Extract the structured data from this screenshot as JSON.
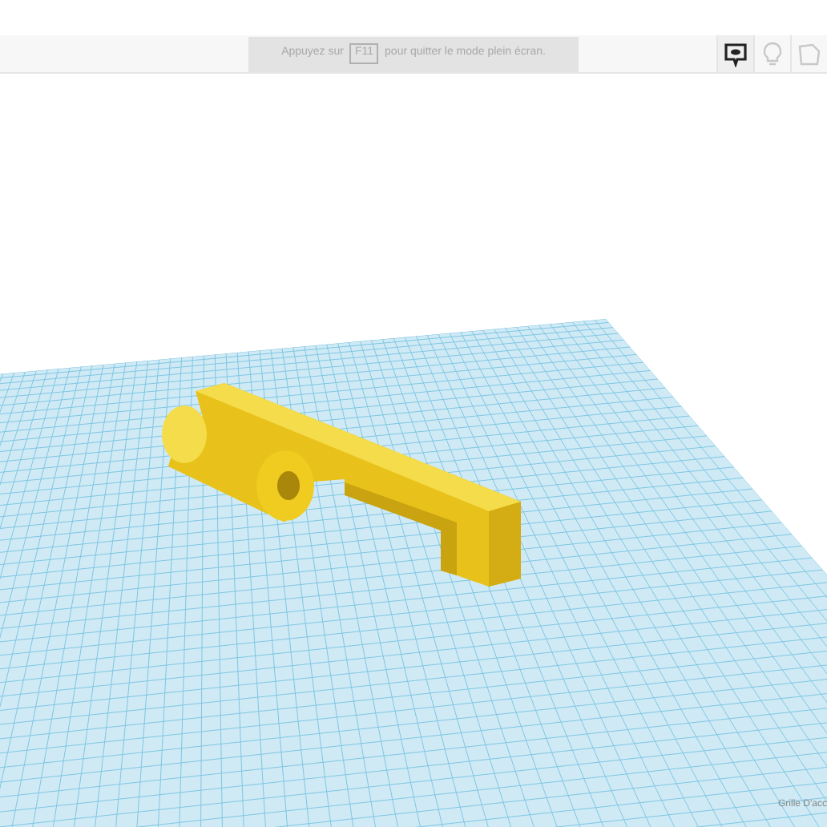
{
  "fullscreen_hint": {
    "before": "Appuyez sur",
    "key": "F11",
    "after": "pour quitter le mode plein écran."
  },
  "view_buttons": [
    {
      "kind": "notes",
      "selected": true
    },
    {
      "kind": "bulb",
      "selected": false
    },
    {
      "kind": "shape",
      "selected": false
    }
  ],
  "grid_label": "Grille D'acc"
}
